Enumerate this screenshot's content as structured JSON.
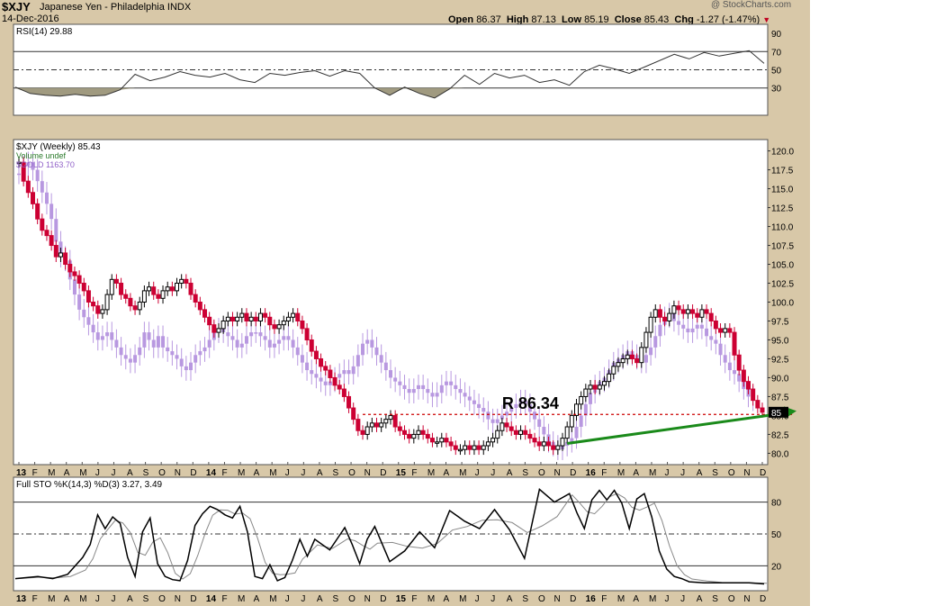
{
  "header": {
    "ticker": "$XJY",
    "name": "Japanese Yen - Philadelphia INDX",
    "date": "14-Dec-2016",
    "copyright": "@ StockCharts.com",
    "open_label": "Open",
    "open": "86.37",
    "high_label": "High",
    "high": "87.13",
    "low_label": "Low",
    "low": "85.19",
    "close_label": "Close",
    "close": "85.43",
    "chg_label": "Chg",
    "chg": "-1.27 (-1.47%)"
  },
  "colors": {
    "frame": "#d8c8a8",
    "up_candle": "#000000",
    "down_candle": "#cc0033",
    "gold_bars": "#b898e0",
    "trendline": "#1a8a1a",
    "resistance": "#cc0000",
    "rsi_fill": "#a09a80"
  },
  "chart_data": [
    {
      "type": "line",
      "panel": "rsi",
      "legend": "RSI(14) 29.88",
      "ylim": [
        0,
        100
      ],
      "y_ticks": [
        30,
        50,
        70,
        90
      ],
      "overbought": 70,
      "oversold": 30,
      "midline": 50,
      "x": [
        0,
        4,
        8,
        12,
        16,
        20,
        24,
        28,
        32,
        36,
        40,
        44,
        48,
        52,
        56,
        60,
        64,
        68,
        72,
        76,
        80,
        84,
        88,
        92,
        96,
        100,
        104,
        108,
        112,
        116,
        120,
        124,
        128,
        132,
        136,
        140,
        144,
        148,
        152,
        156,
        160,
        164,
        168,
        176,
        180,
        184,
        188,
        192,
        196,
        200
      ],
      "values": [
        31,
        24,
        22,
        21,
        23,
        21,
        22,
        28,
        45,
        38,
        42,
        48,
        44,
        42,
        46,
        39,
        36,
        46,
        44,
        47,
        49,
        43,
        49,
        46,
        30,
        22,
        31,
        24,
        19,
        29,
        44,
        34,
        46,
        41,
        44,
        36,
        39,
        33,
        48,
        55,
        51,
        46,
        53,
        67,
        62,
        69,
        65,
        68,
        71,
        57
      ]
    },
    {
      "type": "bar",
      "panel": "price",
      "legend": [
        "$XJY (Weekly) 85.43",
        "Volume undef",
        "$GOLD 1163.70"
      ],
      "ylim": [
        78.5,
        121.5
      ],
      "y_ticks": [
        "80.0",
        "82.5",
        "85.0",
        "87.5",
        "90.0",
        "92.5",
        "95.0",
        "97.5",
        "100.0",
        "102.5",
        "105.0",
        "107.5",
        "110.0",
        "112.5",
        "115.0",
        "117.5",
        "120.0"
      ],
      "x_ticks": [
        "13",
        "F",
        "M",
        "A",
        "M",
        "J",
        "J",
        "A",
        "S",
        "O",
        "N",
        "D",
        "14",
        "F",
        "M",
        "A",
        "M",
        "J",
        "J",
        "A",
        "S",
        "O",
        "N",
        "D",
        "15",
        "F",
        "M",
        "A",
        "M",
        "J",
        "J",
        "A",
        "S",
        "O",
        "N",
        "D",
        "16",
        "F",
        "M",
        "A",
        "M",
        "J",
        "J",
        "A",
        "S",
        "O",
        "N",
        "D"
      ],
      "series": [
        {
          "name": "$XJY",
          "values": [
            118.5,
            116,
            114.5,
            113,
            111,
            109.5,
            108.8,
            107.5,
            106,
            106.5,
            105,
            104,
            103.5,
            102.5,
            101.5,
            100,
            99.5,
            98.5,
            99,
            101,
            103,
            102.5,
            101,
            100.5,
            99.5,
            99,
            100,
            101.5,
            102,
            101,
            100.5,
            101.5,
            102,
            101.5,
            102.5,
            103,
            102.5,
            101,
            100,
            99,
            98,
            97,
            96,
            96.5,
            97.5,
            98,
            97.5,
            98,
            98.5,
            97.5,
            98,
            97.5,
            98.5,
            98,
            97,
            96.5,
            97,
            97.5,
            98,
            98.5,
            97.5,
            96.5,
            95,
            93.5,
            92.5,
            91.5,
            91,
            90,
            89,
            88.5,
            87.5,
            86,
            84.5,
            83,
            82.5,
            83.5,
            84,
            83.5,
            84,
            84.5,
            85,
            83.5,
            83,
            82.5,
            82,
            82.5,
            83,
            82.5,
            82,
            81.5,
            81.5,
            82,
            81.5,
            81,
            80.5,
            80.5,
            81,
            80.5,
            81,
            80.5,
            81,
            81.5,
            82,
            83,
            84,
            83.5,
            83,
            82.5,
            83,
            82.5,
            82,
            81.5,
            81,
            81.5,
            81,
            80.5,
            81,
            82,
            83.5,
            85,
            86.5,
            87.5,
            88.5,
            89,
            88.5,
            89,
            89.5,
            90.5,
            91.5,
            92,
            92.5,
            93,
            92.5,
            92,
            94,
            96,
            98,
            99,
            98,
            97.5,
            98.5,
            99.5,
            99,
            98.5,
            99,
            98.5,
            98,
            99,
            98.5,
            97.5,
            96.5,
            96,
            96.5,
            96,
            93,
            91,
            89.5,
            88.5,
            87,
            86,
            85.43
          ]
        },
        {
          "name": "$GOLD",
          "values": [
            117,
            118,
            118.5,
            117.5,
            116,
            114.5,
            113,
            111,
            108,
            106,
            105.5,
            103,
            101,
            99,
            98,
            97,
            96,
            95,
            95.5,
            96,
            95,
            94,
            93,
            92.5,
            92,
            93,
            94,
            96,
            95,
            94,
            95.5,
            94,
            93.5,
            93,
            92.5,
            91.5,
            91,
            92,
            93,
            93.5,
            94,
            95,
            96,
            96.5,
            96,
            95.5,
            95,
            94,
            94.5,
            95.5,
            96,
            96,
            95.5,
            95,
            94,
            94.5,
            95,
            95.5,
            95,
            94,
            93,
            92,
            91,
            90.5,
            90,
            89.5,
            89,
            89.5,
            90,
            90.5,
            91,
            90.5,
            91.5,
            93,
            94.5,
            95,
            94,
            93,
            92,
            91,
            90,
            89.5,
            89,
            88.5,
            88,
            88.5,
            89,
            88.5,
            88,
            87.5,
            88,
            89,
            89.5,
            89,
            88.5,
            88,
            87.5,
            87,
            86.5,
            86,
            85.5,
            84.5,
            84,
            84.5,
            85,
            85.5,
            86,
            86.5,
            87,
            86.5,
            85.5,
            84.5,
            83.5,
            82.5,
            81.5,
            81,
            80.5,
            81,
            81.5,
            82,
            83.5,
            85,
            86.5,
            88,
            89,
            89.5,
            90,
            91,
            92,
            92.5,
            93,
            93.5,
            93,
            92.5,
            92,
            93,
            94,
            95.5,
            97,
            98,
            98.5,
            97.5,
            97,
            96.5,
            96,
            96.5,
            97,
            96.5,
            95.5,
            95,
            94.5,
            93,
            92,
            91,
            90.5,
            89.5,
            88.5,
            87.5,
            87
          ]
        }
      ],
      "annotations": {
        "resistance_label": "R 86.34",
        "resistance_level": 86.34,
        "trendline_from": [
          118,
          81.3
        ],
        "trendline_to": [
          165,
          85.6
        ],
        "price_tag": "85"
      }
    },
    {
      "type": "line",
      "panel": "stochastic",
      "legend": "Full STO %K(14,3) %D(3) 3.27, 3.49",
      "ylim": [
        0,
        100
      ],
      "y_ticks": [
        20,
        50,
        80
      ],
      "series": [
        {
          "name": "%K",
          "x": [
            0,
            6,
            10,
            14,
            18,
            20,
            22,
            24,
            26,
            28,
            30,
            32,
            34,
            36,
            38,
            40,
            42,
            44,
            46,
            48,
            50,
            52,
            54,
            56,
            58,
            60,
            62,
            64,
            66,
            68,
            70,
            72,
            74,
            76,
            78,
            80,
            84,
            88,
            90,
            92,
            94,
            96,
            100,
            104,
            108,
            112,
            116,
            120,
            124,
            128,
            132,
            136,
            140,
            144,
            148,
            150,
            152,
            154,
            156,
            158,
            160,
            162,
            164,
            166,
            168,
            170,
            172,
            174,
            176,
            178,
            180,
            184,
            188,
            192,
            196,
            200
          ],
          "values": [
            8,
            10,
            8,
            12,
            28,
            40,
            68,
            55,
            66,
            60,
            28,
            10,
            52,
            65,
            22,
            10,
            7,
            6,
            25,
            58,
            69,
            76,
            73,
            68,
            65,
            76,
            52,
            10,
            8,
            21,
            6,
            9,
            25,
            45,
            29,
            45,
            35,
            56,
            40,
            22,
            45,
            57,
            24,
            34,
            52,
            37,
            72,
            62,
            55,
            73,
            54,
            27,
            92,
            80,
            88,
            70,
            55,
            82,
            91,
            82,
            91,
            79,
            55,
            83,
            88,
            66,
            34,
            17,
            10,
            8,
            5,
            4,
            4,
            4,
            4,
            3
          ]
        }
      ]
    }
  ]
}
